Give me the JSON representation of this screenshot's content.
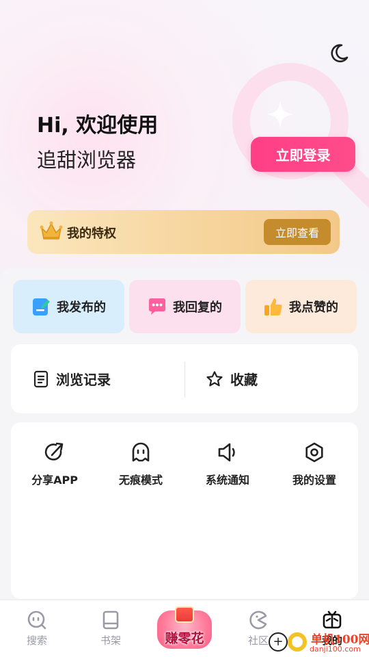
{
  "header": {
    "greeting": "Hi, 欢迎使用",
    "app_name": "追甜浏览器",
    "login_label": "立即登录",
    "theme_icon": "moon-icon"
  },
  "privilege": {
    "title": "我的特权",
    "button_label": "立即查看",
    "icon": "crown-icon"
  },
  "quick_actions": [
    {
      "label": "我发布的",
      "icon": "edit-note-icon"
    },
    {
      "label": "我回复的",
      "icon": "chat-bubble-icon"
    },
    {
      "label": "我点赞的",
      "icon": "thumbs-up-icon"
    }
  ],
  "records": {
    "history_label": "浏览记录",
    "favorites_label": "收藏"
  },
  "tools": [
    {
      "label": "分享APP",
      "icon": "share-icon"
    },
    {
      "label": "无痕模式",
      "icon": "ghost-icon"
    },
    {
      "label": "系统通知",
      "icon": "speaker-icon"
    },
    {
      "label": "我的设置",
      "icon": "settings-hex-icon"
    }
  ],
  "tabbar": {
    "tabs": [
      {
        "label": "搜索",
        "icon": "search-face-icon"
      },
      {
        "label": "书架",
        "icon": "book-icon"
      },
      {
        "label": "赚零花",
        "icon": "red-envelope-icon"
      },
      {
        "label": "社区",
        "icon": "pacman-icon"
      },
      {
        "label": "我的",
        "icon": "tv-face-icon"
      }
    ],
    "active": "我的"
  },
  "watermark": {
    "name": "单机100网",
    "url": "danji100.com"
  },
  "colors": {
    "accent_pink": "#ff3f86",
    "gold": "#c48c2d",
    "blue_tile": "#d9eefd",
    "pink_tile": "#fde0ee",
    "orange_tile": "#feeadb"
  }
}
